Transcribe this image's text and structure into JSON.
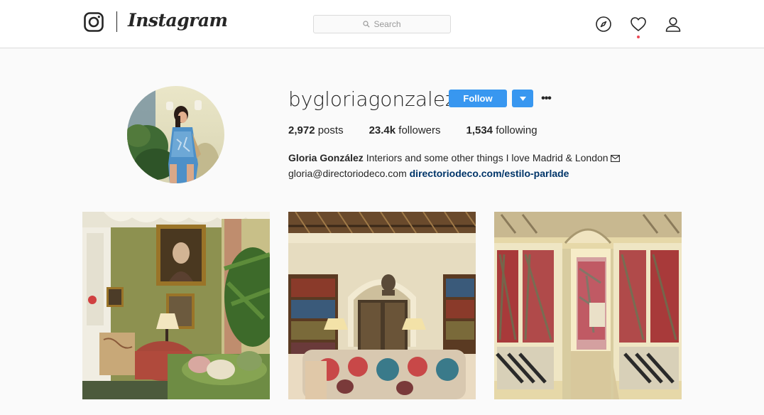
{
  "header": {
    "wordmark": "Instagram",
    "search_placeholder": "Search",
    "icons": [
      "camera-logo-icon",
      "compass-icon",
      "heart-icon",
      "person-icon"
    ]
  },
  "profile": {
    "username": "bygloriagonzalez",
    "follow_label": "Follow",
    "more_label": "•••",
    "stats": {
      "posts_count": "2,972",
      "posts_label": "posts",
      "followers_count": "23.4k",
      "followers_label": "followers",
      "following_count": "1,534",
      "following_label": "following"
    },
    "bio": {
      "full_name": "Gloria González",
      "text": "Interiors and some other things I love Madrid & London",
      "email": "gloria@directoriodeco.com",
      "link": "directoriodeco.com/estilo-parlade"
    }
  },
  "posts": [
    {
      "label": "post-1"
    },
    {
      "label": "post-2"
    },
    {
      "label": "post-3"
    }
  ],
  "colors": {
    "accent": "#3897f0",
    "link": "#003569",
    "notification": "#ed4956",
    "background": "#fafafa"
  }
}
